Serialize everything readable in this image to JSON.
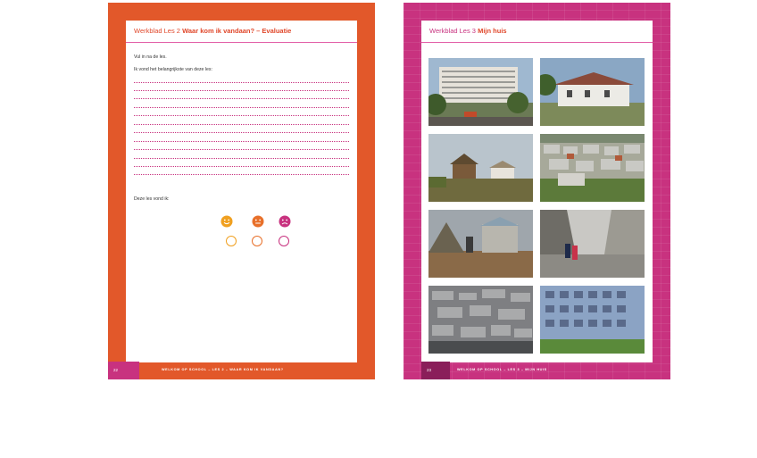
{
  "left_page": {
    "header_prefix": "Werkblad Les 2",
    "header_title": "Waar kom ik vandaan? – Evaluatie",
    "instruction": "Vul in na de les.",
    "prompt": "Ik vond het belangrijkste van deze les:",
    "rating_label": "Deze les vond ik:",
    "faces": [
      {
        "name": "happy",
        "color": "#f0a020"
      },
      {
        "name": "neutral",
        "color": "#e8702a"
      },
      {
        "name": "sad",
        "color": "#c8327f"
      }
    ],
    "footer_page": "22",
    "footer_text": "WELKOM OP SCHOOL – LES 2 – WAAR KOM IK VANDAAN?"
  },
  "right_page": {
    "header_prefix": "Werkblad Les 3",
    "header_title": "Mijn huis",
    "footer_page": "23",
    "footer_text": "WELKOM OP SCHOOL – LES 3 – MIJN HUIS",
    "photos": [
      "apartment-blocks-photo",
      "white-house-photo",
      "round-hut-photo",
      "tent-camp-photo",
      "makeshift-shelters-photo",
      "street-children-photo",
      "slum-roofs-photo",
      "apartment-facade-photo"
    ]
  },
  "colors": {
    "orange": "#e2582a",
    "magenta": "#c8327f",
    "yellow": "#f0a020"
  }
}
